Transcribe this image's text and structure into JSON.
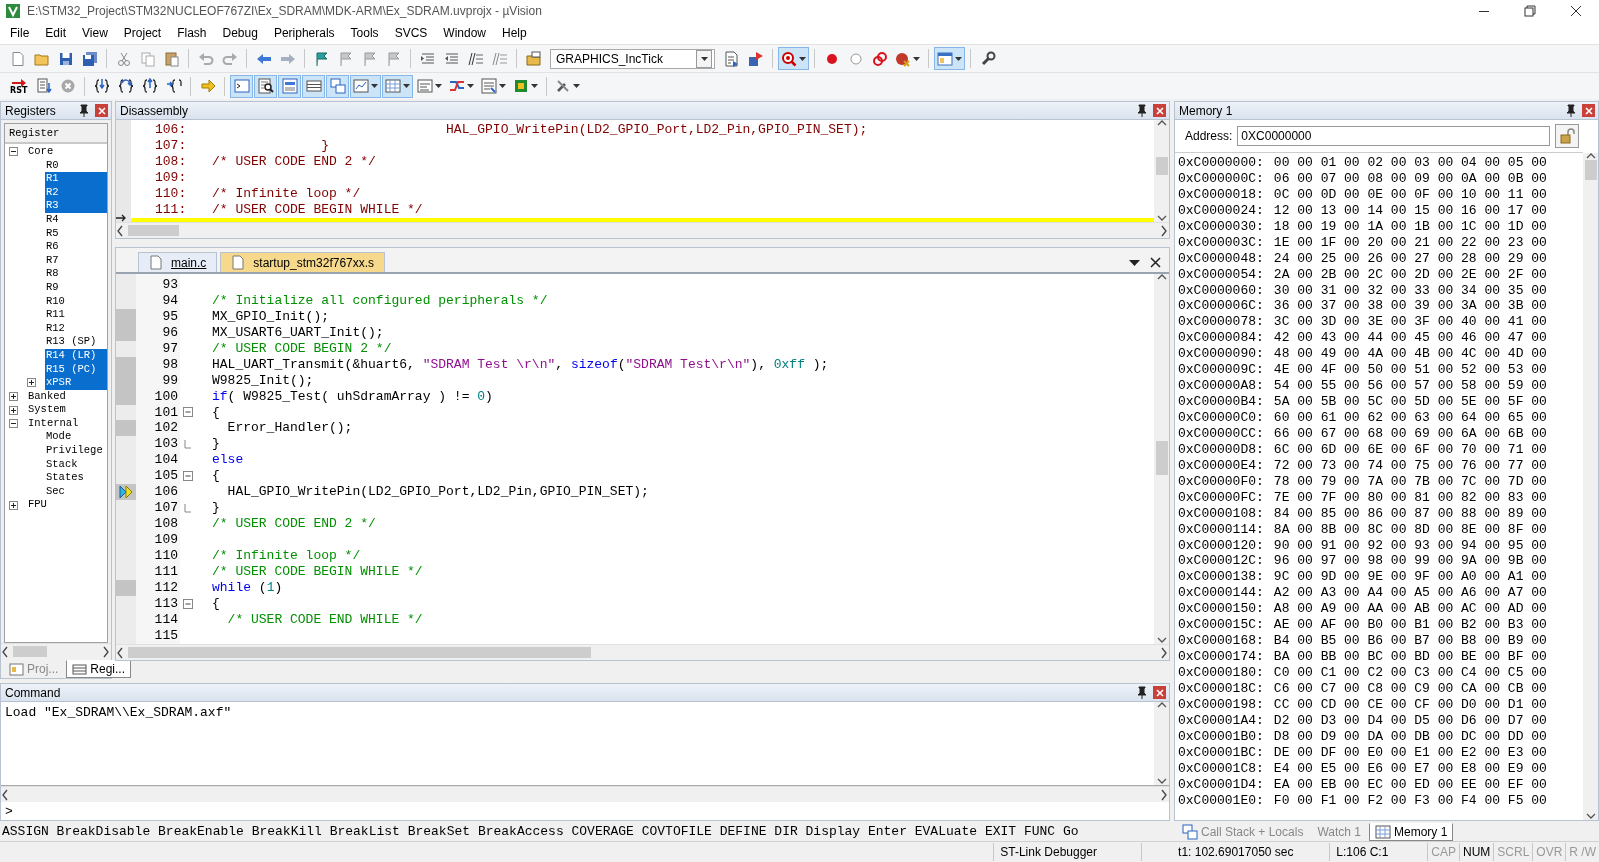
{
  "window": {
    "title": "E:\\STM32_Project\\STM32NUCLEOF767ZI\\Ex_SDRAM\\MDK-ARM\\Ex_SDRAM.uvprojx - µVision"
  },
  "menu": [
    "File",
    "Edit",
    "View",
    "Project",
    "Flash",
    "Debug",
    "Peripherals",
    "Tools",
    "SVCS",
    "Window",
    "Help"
  ],
  "file_toolbar": {
    "target": "GRAPHICS_IncTick",
    "buttons": [
      {
        "pressed": false
      },
      {
        "pressed": false
      },
      {
        "pressed": false
      },
      {
        "pressed": false
      },
      {
        "pressed": false
      },
      {
        "pressed": false
      },
      {
        "pressed": false
      },
      {
        "pressed": false
      },
      {
        "pressed": false
      },
      {
        "pressed": false
      },
      {
        "pressed": false
      },
      {
        "pressed": false
      },
      {
        "pressed": false
      },
      {
        "pressed": false
      },
      {
        "pressed": false
      },
      {
        "pressed": false
      },
      {
        "pressed": false
      },
      {
        "pressed": false
      },
      {
        "pressed": false
      },
      {
        "pressed": false
      },
      {
        "pressed": false
      },
      {
        "pressed": false
      },
      {
        "pressed": true
      },
      {
        "pressed": false
      },
      {
        "pressed": false
      },
      {
        "pressed": false
      },
      {
        "pressed": false
      },
      {
        "pressed": true
      },
      {
        "pressed": false
      }
    ]
  },
  "debug_toolbar": {
    "reset_label": "RST",
    "buttons": [
      {
        "pressed": false
      },
      {
        "pressed": false
      },
      {
        "pressed": false
      },
      {
        "pressed": false
      },
      {
        "pressed": false
      },
      {
        "pressed": false
      },
      {
        "pressed": false
      },
      {
        "pressed": false
      },
      {
        "pressed": true
      },
      {
        "pressed": true
      },
      {
        "pressed": true
      },
      {
        "pressed": true
      },
      {
        "pressed": true
      },
      {
        "pressed": true
      },
      {
        "pressed": true
      },
      {
        "pressed": false
      },
      {
        "pressed": false
      },
      {
        "pressed": false
      },
      {
        "pressed": false
      },
      {
        "pressed": false
      }
    ]
  },
  "registers": {
    "title": "Registers",
    "header": "Register",
    "tree": [
      {
        "label": "Core",
        "kind": "group",
        "expanded": true,
        "selected": false,
        "children": [
          {
            "label": "R0",
            "kind": "leaf",
            "selected": false
          },
          {
            "label": "R1",
            "kind": "leaf",
            "selected": true
          },
          {
            "label": "R2",
            "kind": "leaf",
            "selected": true
          },
          {
            "label": "R3",
            "kind": "leaf",
            "selected": true
          },
          {
            "label": "R4",
            "kind": "leaf",
            "selected": false
          },
          {
            "label": "R5",
            "kind": "leaf",
            "selected": false
          },
          {
            "label": "R6",
            "kind": "leaf",
            "selected": false
          },
          {
            "label": "R7",
            "kind": "leaf",
            "selected": false
          },
          {
            "label": "R8",
            "kind": "leaf",
            "selected": false
          },
          {
            "label": "R9",
            "kind": "leaf",
            "selected": false
          },
          {
            "label": "R10",
            "kind": "leaf",
            "selected": false
          },
          {
            "label": "R11",
            "kind": "leaf",
            "selected": false
          },
          {
            "label": "R12",
            "kind": "leaf",
            "selected": false
          },
          {
            "label": "R13 (SP)",
            "kind": "leaf",
            "selected": false
          },
          {
            "label": "R14 (LR)",
            "kind": "leaf",
            "selected": true
          },
          {
            "label": "R15 (PC)",
            "kind": "leaf",
            "selected": true
          },
          {
            "label": "xPSR",
            "kind": "group",
            "expanded": false,
            "selected": true
          }
        ]
      },
      {
        "label": "Banked",
        "kind": "group",
        "expanded": false,
        "selected": false
      },
      {
        "label": "System",
        "kind": "group",
        "expanded": false,
        "selected": false
      },
      {
        "label": "Internal",
        "kind": "group",
        "expanded": true,
        "selected": false,
        "children": [
          {
            "label": "Mode",
            "kind": "leaf",
            "selected": false
          },
          {
            "label": "Privilege",
            "kind": "leaf",
            "selected": false
          },
          {
            "label": "Stack",
            "kind": "leaf",
            "selected": false
          },
          {
            "label": "States",
            "kind": "leaf",
            "selected": false
          },
          {
            "label": "Sec",
            "kind": "leaf",
            "selected": false
          }
        ]
      },
      {
        "label": "FPU",
        "kind": "group",
        "expanded": false,
        "selected": false
      }
    ],
    "tabs": [
      {
        "label": "Proj...",
        "selected": false
      },
      {
        "label": "Regi...",
        "selected": true
      }
    ]
  },
  "disassembly": {
    "title": "Disassembly",
    "current_line_marker": true,
    "lines": [
      {
        "number": "106:",
        "code": "                              HAL_GPIO_WritePin(LD2_GPIO_Port,LD2_Pin,GPIO_PIN_SET);"
      },
      {
        "number": "107:",
        "code": "              }"
      },
      {
        "number": "108:",
        "code": "/* USER CODE END 2 */"
      },
      {
        "number": "109:"
      },
      {
        "number": "110:",
        "code": "/* Infinite loop */"
      },
      {
        "number": "111:",
        "code": "/* USER CODE BEGIN WHILE */"
      }
    ]
  },
  "editor": {
    "tabs": [
      {
        "label": "main.c",
        "selected": true
      },
      {
        "label": "startup_stm32f767xx.s",
        "selected": false
      }
    ],
    "lines": [
      {
        "number": "93",
        "executed": false,
        "current": false,
        "fold_start": false,
        "fold_end": false
      },
      {
        "number": "94",
        "executed": false,
        "current": false,
        "fold_start": false,
        "fold_end": false,
        "tokens": [
          {
            "kind": "comment",
            "text": "/* Initialize all configured peripherals */"
          }
        ]
      },
      {
        "number": "95",
        "executed": true,
        "current": false,
        "fold_start": false,
        "fold_end": false,
        "tokens": [
          {
            "kind": "plain",
            "text": "MX_GPIO_Init();"
          }
        ]
      },
      {
        "number": "96",
        "executed": true,
        "current": false,
        "fold_start": false,
        "fold_end": false,
        "tokens": [
          {
            "kind": "plain",
            "text": "MX_USART6_UART_Init();"
          }
        ]
      },
      {
        "number": "97",
        "executed": false,
        "current": false,
        "fold_start": false,
        "fold_end": false,
        "tokens": [
          {
            "kind": "comment",
            "text": "/* USER CODE BEGIN 2 */"
          }
        ]
      },
      {
        "number": "98",
        "executed": true,
        "current": false,
        "fold_start": false,
        "fold_end": false,
        "tokens": [
          {
            "kind": "plain",
            "text": "HAL_UART_Transmit(&huart6, "
          },
          {
            "kind": "string",
            "text": "\"SDRAM Test \\r\\n\""
          },
          {
            "kind": "plain",
            "text": ", "
          },
          {
            "kind": "keyword",
            "text": "sizeof"
          },
          {
            "kind": "plain",
            "text": "("
          },
          {
            "kind": "string",
            "text": "\"SDRAM Test\\r\\n\""
          },
          {
            "kind": "plain",
            "text": "), "
          },
          {
            "kind": "number",
            "text": "0xff"
          },
          {
            "kind": "plain",
            "text": " );"
          }
        ]
      },
      {
        "number": "99",
        "executed": true,
        "current": false,
        "fold_start": false,
        "fold_end": false,
        "tokens": [
          {
            "kind": "plain",
            "text": "W9825_Init();"
          }
        ]
      },
      {
        "number": "100",
        "executed": true,
        "current": false,
        "fold_start": false,
        "fold_end": false,
        "tokens": [
          {
            "kind": "keyword",
            "text": "if"
          },
          {
            "kind": "plain",
            "text": "( W9825_Test( uhSdramArray ) != "
          },
          {
            "kind": "number",
            "text": "0"
          },
          {
            "kind": "plain",
            "text": ")"
          }
        ]
      },
      {
        "number": "101",
        "executed": false,
        "current": false,
        "fold_start": true,
        "fold_end": false,
        "tokens": [
          {
            "kind": "plain",
            "text": "{"
          }
        ]
      },
      {
        "number": "102",
        "executed": true,
        "current": false,
        "fold_start": false,
        "fold_end": false,
        "tokens": [
          {
            "kind": "plain",
            "text": "  Error_Handler();"
          }
        ]
      },
      {
        "number": "103",
        "executed": false,
        "current": false,
        "fold_start": false,
        "fold_end": true,
        "tokens": [
          {
            "kind": "plain",
            "text": "}"
          }
        ]
      },
      {
        "number": "104",
        "executed": false,
        "current": false,
        "fold_start": false,
        "fold_end": false,
        "tokens": [
          {
            "kind": "keyword",
            "text": "else"
          }
        ]
      },
      {
        "number": "105",
        "executed": false,
        "current": false,
        "fold_start": true,
        "fold_end": false,
        "tokens": [
          {
            "kind": "plain",
            "text": "{"
          }
        ]
      },
      {
        "number": "106",
        "executed": true,
        "current": true,
        "fold_start": false,
        "fold_end": false,
        "tokens": [
          {
            "kind": "plain",
            "text": "  HAL_GPIO_WritePin(LD2_GPIO_Port,LD2_Pin,GPIO_PIN_SET);"
          }
        ]
      },
      {
        "number": "107",
        "executed": false,
        "current": false,
        "fold_start": false,
        "fold_end": true,
        "tokens": [
          {
            "kind": "plain",
            "text": "}"
          }
        ]
      },
      {
        "number": "108",
        "executed": false,
        "current": false,
        "fold_start": false,
        "fold_end": false,
        "tokens": [
          {
            "kind": "comment",
            "text": "/* USER CODE END 2 */"
          }
        ]
      },
      {
        "number": "109",
        "executed": false,
        "current": false,
        "fold_start": false,
        "fold_end": false
      },
      {
        "number": "110",
        "executed": false,
        "current": false,
        "fold_start": false,
        "fold_end": false,
        "tokens": [
          {
            "kind": "comment",
            "text": "/* Infinite loop */"
          }
        ]
      },
      {
        "number": "111",
        "executed": false,
        "current": false,
        "fold_start": false,
        "fold_end": false,
        "tokens": [
          {
            "kind": "comment",
            "text": "/* USER CODE BEGIN WHILE */"
          }
        ]
      },
      {
        "number": "112",
        "executed": true,
        "current": false,
        "fold_start": false,
        "fold_end": false,
        "tokens": [
          {
            "kind": "keyword",
            "text": "while"
          },
          {
            "kind": "plain",
            "text": " ("
          },
          {
            "kind": "number",
            "text": "1"
          },
          {
            "kind": "plain",
            "text": ")"
          }
        ]
      },
      {
        "number": "113",
        "executed": false,
        "current": false,
        "fold_start": true,
        "fold_end": false,
        "tokens": [
          {
            "kind": "plain",
            "text": "{"
          }
        ]
      },
      {
        "number": "114",
        "executed": false,
        "current": false,
        "fold_start": false,
        "fold_end": false,
        "tokens": [
          {
            "kind": "comment",
            "text": "  /* USER CODE END WHILE */"
          }
        ]
      },
      {
        "number": "115",
        "executed": false,
        "current": false,
        "fold_start": false,
        "fold_end": false
      }
    ]
  },
  "command": {
    "title": "Command",
    "output": [
      "Load \"Ex_SDRAM\\\\Ex_SDRAM.axf\""
    ],
    "prompt": ">",
    "hints": "ASSIGN BreakDisable BreakEnable BreakKill BreakList BreakSet BreakAccess COVERAGE COVTOFILE DEFINE DIR Display Enter EVALuate EXIT FUNC Go"
  },
  "memory": {
    "title": "Memory 1",
    "address_label": "Address:",
    "address": "0XC0000000",
    "rows": [
      {
        "address": "0xC0000000:",
        "bytes": "00 00 01 00 02 00 03 00 04 00 05 00"
      },
      {
        "address": "0xC000000C:",
        "bytes": "06 00 07 00 08 00 09 00 0A 00 0B 00"
      },
      {
        "address": "0xC0000018:",
        "bytes": "0C 00 0D 00 0E 00 0F 00 10 00 11 00"
      },
      {
        "address": "0xC0000024:",
        "bytes": "12 00 13 00 14 00 15 00 16 00 17 00"
      },
      {
        "address": "0xC0000030:",
        "bytes": "18 00 19 00 1A 00 1B 00 1C 00 1D 00"
      },
      {
        "address": "0xC000003C:",
        "bytes": "1E 00 1F 00 20 00 21 00 22 00 23 00"
      },
      {
        "address": "0xC0000048:",
        "bytes": "24 00 25 00 26 00 27 00 28 00 29 00"
      },
      {
        "address": "0xC0000054:",
        "bytes": "2A 00 2B 00 2C 00 2D 00 2E 00 2F 00"
      },
      {
        "address": "0xC0000060:",
        "bytes": "30 00 31 00 32 00 33 00 34 00 35 00"
      },
      {
        "address": "0xC000006C:",
        "bytes": "36 00 37 00 38 00 39 00 3A 00 3B 00"
      },
      {
        "address": "0xC0000078:",
        "bytes": "3C 00 3D 00 3E 00 3F 00 40 00 41 00"
      },
      {
        "address": "0xC0000084:",
        "bytes": "42 00 43 00 44 00 45 00 46 00 47 00"
      },
      {
        "address": "0xC0000090:",
        "bytes": "48 00 49 00 4A 00 4B 00 4C 00 4D 00"
      },
      {
        "address": "0xC000009C:",
        "bytes": "4E 00 4F 00 50 00 51 00 52 00 53 00"
      },
      {
        "address": "0xC00000A8:",
        "bytes": "54 00 55 00 56 00 57 00 58 00 59 00"
      },
      {
        "address": "0xC00000B4:",
        "bytes": "5A 00 5B 00 5C 00 5D 00 5E 00 5F 00"
      },
      {
        "address": "0xC00000C0:",
        "bytes": "60 00 61 00 62 00 63 00 64 00 65 00"
      },
      {
        "address": "0xC00000CC:",
        "bytes": "66 00 67 00 68 00 69 00 6A 00 6B 00"
      },
      {
        "address": "0xC00000D8:",
        "bytes": "6C 00 6D 00 6E 00 6F 00 70 00 71 00"
      },
      {
        "address": "0xC00000E4:",
        "bytes": "72 00 73 00 74 00 75 00 76 00 77 00"
      },
      {
        "address": "0xC00000F0:",
        "bytes": "78 00 79 00 7A 00 7B 00 7C 00 7D 00"
      },
      {
        "address": "0xC00000FC:",
        "bytes": "7E 00 7F 00 80 00 81 00 82 00 83 00"
      },
      {
        "address": "0xC0000108:",
        "bytes": "84 00 85 00 86 00 87 00 88 00 89 00"
      },
      {
        "address": "0xC0000114:",
        "bytes": "8A 00 8B 00 8C 00 8D 00 8E 00 8F 00"
      },
      {
        "address": "0xC0000120:",
        "bytes": "90 00 91 00 92 00 93 00 94 00 95 00"
      },
      {
        "address": "0xC000012C:",
        "bytes": "96 00 97 00 98 00 99 00 9A 00 9B 00"
      },
      {
        "address": "0xC0000138:",
        "bytes": "9C 00 9D 00 9E 00 9F 00 A0 00 A1 00"
      },
      {
        "address": "0xC0000144:",
        "bytes": "A2 00 A3 00 A4 00 A5 00 A6 00 A7 00"
      },
      {
        "address": "0xC0000150:",
        "bytes": "A8 00 A9 00 AA 00 AB 00 AC 00 AD 00"
      },
      {
        "address": "0xC000015C:",
        "bytes": "AE 00 AF 00 B0 00 B1 00 B2 00 B3 00"
      },
      {
        "address": "0xC0000168:",
        "bytes": "B4 00 B5 00 B6 00 B7 00 B8 00 B9 00"
      },
      {
        "address": "0xC0000174:",
        "bytes": "BA 00 BB 00 BC 00 BD 00 BE 00 BF 00"
      },
      {
        "address": "0xC0000180:",
        "bytes": "C0 00 C1 00 C2 00 C3 00 C4 00 C5 00"
      },
      {
        "address": "0xC000018C:",
        "bytes": "C6 00 C7 00 C8 00 C9 00 CA 00 CB 00"
      },
      {
        "address": "0xC0000198:",
        "bytes": "CC 00 CD 00 CE 00 CF 00 D0 00 D1 00"
      },
      {
        "address": "0xC00001A4:",
        "bytes": "D2 00 D3 00 D4 00 D5 00 D6 00 D7 00"
      },
      {
        "address": "0xC00001B0:",
        "bytes": "D8 00 D9 00 DA 00 DB 00 DC 00 DD 00"
      },
      {
        "address": "0xC00001BC:",
        "bytes": "DE 00 DF 00 E0 00 E1 00 E2 00 E3 00"
      },
      {
        "address": "0xC00001C8:",
        "bytes": "E4 00 E5 00 E6 00 E7 00 E8 00 E9 00"
      },
      {
        "address": "0xC00001D4:",
        "bytes": "EA 00 EB 00 EC 00 ED 00 EE 00 EF 00"
      },
      {
        "address": "0xC00001E0:",
        "bytes": "F0 00 F1 00 F2 00 F3 00 F4 00 F5 00"
      }
    ],
    "tabs": [
      {
        "label": "Call Stack + Locals",
        "selected": false
      },
      {
        "label": "Watch 1",
        "selected": false
      },
      {
        "label": "Memory 1",
        "selected": true
      }
    ]
  },
  "status_bar": {
    "debugger": "ST-Link Debugger",
    "time": "t1: 102.69017050 sec",
    "position": "L:106 C:1",
    "indicators": [
      {
        "label": "CAP",
        "on": false
      },
      {
        "label": "NUM",
        "on": true
      },
      {
        "label": "SCRL",
        "on": false
      },
      {
        "label": "OVR",
        "on": false
      },
      {
        "label": "R /W",
        "on": false
      }
    ]
  }
}
